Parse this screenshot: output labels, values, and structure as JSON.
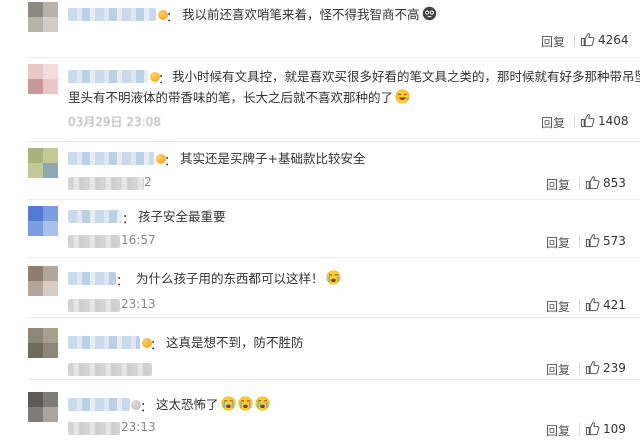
{
  "comments": [
    {
      "text": "我以前还喜欢哨笔来着，怪不得我智商不高",
      "time": "",
      "reply": "回复",
      "likes": "4264"
    },
    {
      "line1": "我小时候有文具控，就是喜欢买很多好看的笔文具之类的，那时候就有好多那种带吊坠的",
      "line2": "里头有不明液体的带香味的笔，长大之后就不喜欢那种的了",
      "time": "03月29日 23:08",
      "reply": "回复",
      "likes": "1408"
    },
    {
      "text": "其实还是买牌子+基础款比较安全",
      "time": "2",
      "reply": "回复",
      "likes": "853"
    },
    {
      "text": "孩子安全最重要",
      "time": "16:57",
      "reply": "回复",
      "likes": "573"
    },
    {
      "text": "为什么孩子用的东西都可以这样！",
      "time": "23:13",
      "reply": "回复",
      "likes": "421"
    },
    {
      "text": "这真是想不到，防不胜防",
      "time": "",
      "reply": "回复",
      "likes": "239"
    },
    {
      "text": "这太恐怖了",
      "time": "23:13",
      "reply": "回复",
      "likes": "109"
    }
  ],
  "colon": "：",
  "icons": {
    "like": "thumbs-up-icon",
    "cry": "crying-face-icon",
    "laugh": "laughing-face-icon",
    "awkward": "speechless-face-icon"
  }
}
